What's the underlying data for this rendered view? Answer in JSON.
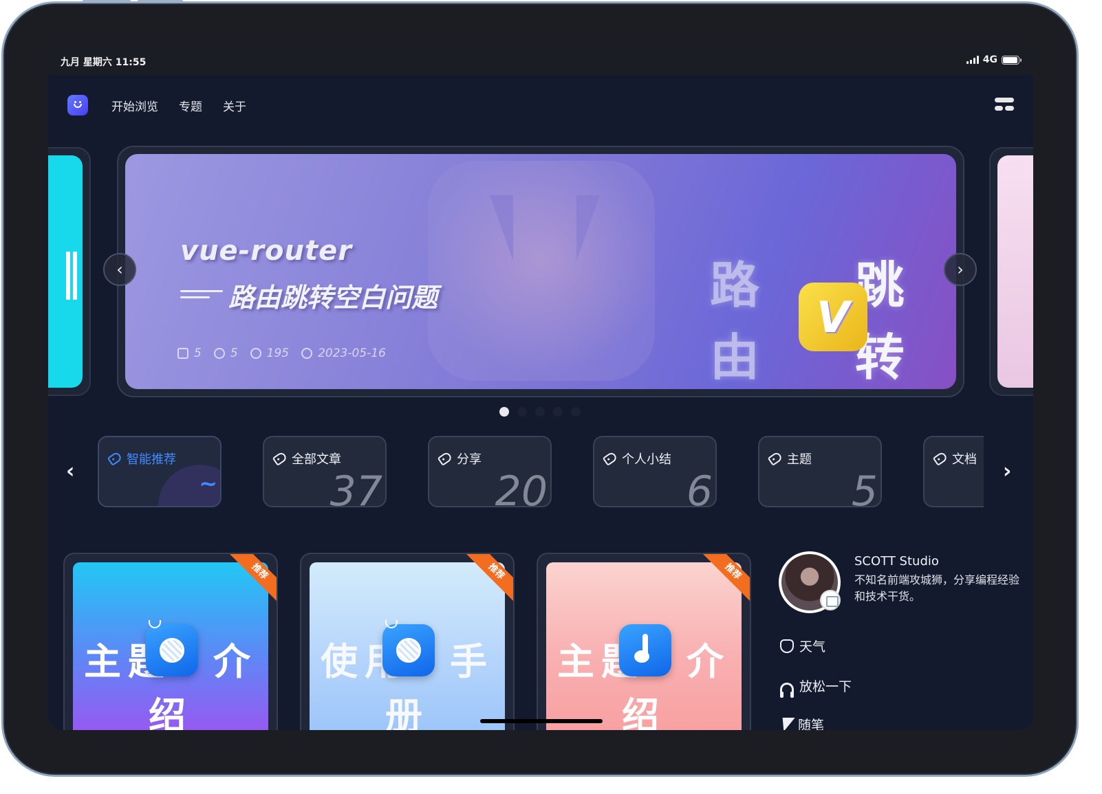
{
  "status_bar": {
    "time": "九月 星期六 11:55",
    "network": "4G",
    "battery_level": 0.95
  },
  "nav": {
    "links": [
      "开始浏览",
      "专题",
      "关于"
    ],
    "logo_icon": "smile-logo-icon",
    "menu_icon": "menu-icon"
  },
  "carousel": {
    "slide": {
      "title_en": "vue-router",
      "title_cn": "路由跳转空白问题",
      "banner_left": "路由",
      "banner_badge": "V",
      "banner_right": "跳转",
      "likes": "5",
      "comments": "5",
      "views": "195",
      "date": "2023-05-16"
    },
    "prev_label": "‹",
    "next_label": "›",
    "dot_count": 5,
    "active_dot": 0
  },
  "categories": {
    "prev_label": "‹",
    "next_label": "›",
    "items": [
      {
        "label": "智能推荐",
        "count": "~"
      },
      {
        "label": "全部文章",
        "count": "37"
      },
      {
        "label": "分享",
        "count": "20"
      },
      {
        "label": "个人小结",
        "count": "6"
      },
      {
        "label": "主题",
        "count": "5"
      },
      {
        "label": "文档",
        "count": ""
      }
    ]
  },
  "articles": [
    {
      "title_left": "主题",
      "title_right": "介绍",
      "ribbon": "推荐",
      "icon": "basketball-app-icon"
    },
    {
      "title_left": "使用",
      "title_right": "手册",
      "ribbon": "推荐",
      "icon": "basketball-app-icon"
    },
    {
      "title_left": "主题",
      "title_right": "介绍",
      "ribbon": "推荐",
      "icon": "music-note-app-icon"
    }
  ],
  "profile": {
    "name": "SCOTT Studio",
    "description": "不知名前端攻城狮，分享编程经验和技术干货。",
    "menu": [
      "天气",
      "放松一下",
      "随笔"
    ]
  },
  "colors": {
    "background": "#131a2d",
    "accent": "#3f8bff",
    "ribbon": "#f36d21"
  }
}
